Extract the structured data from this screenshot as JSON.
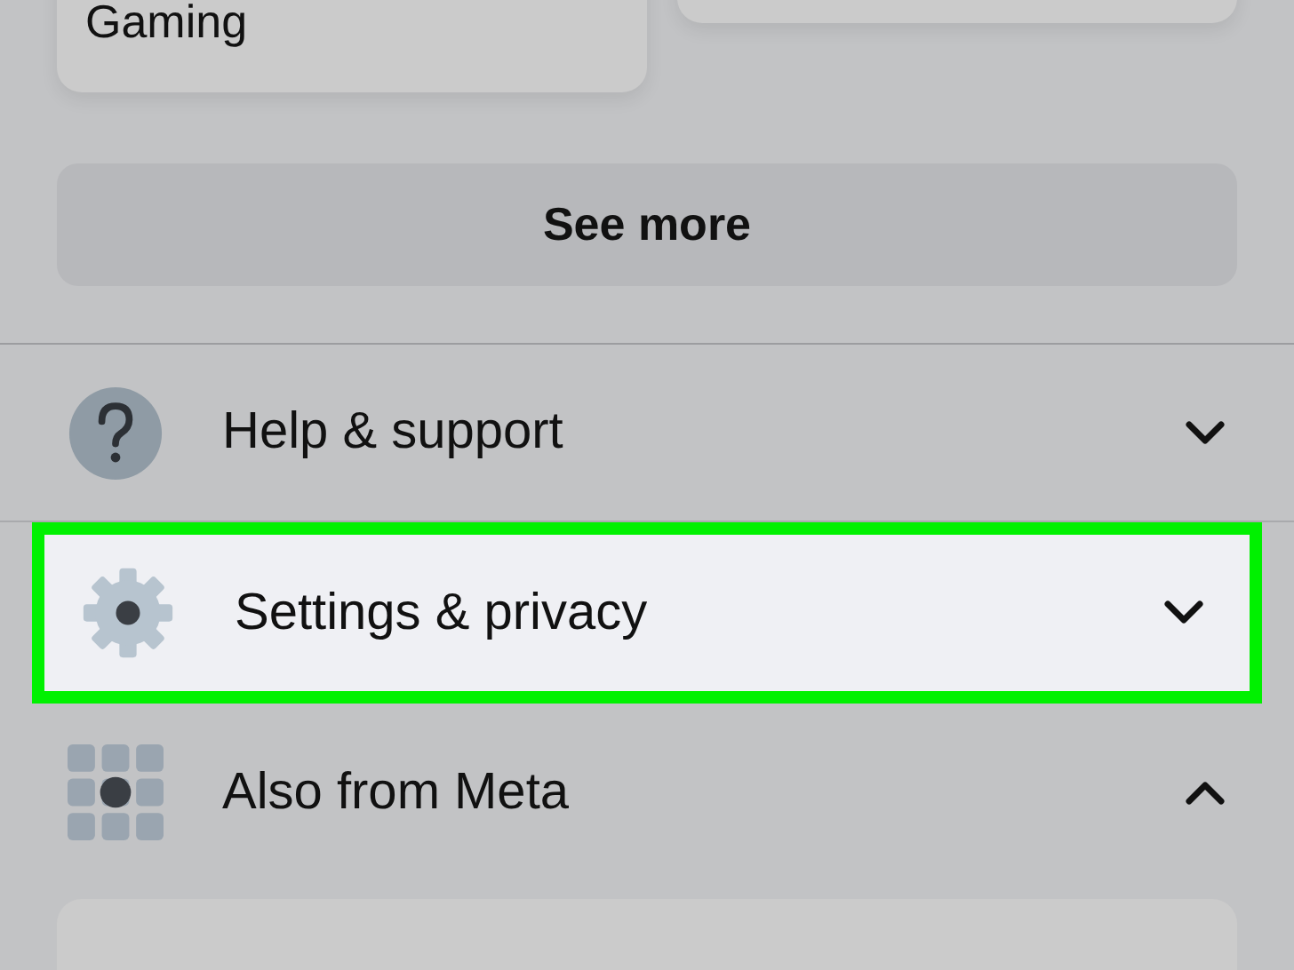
{
  "shortcut_cards": [
    {
      "kind": "labeled",
      "label": "Gaming"
    },
    {
      "kind": "blank"
    }
  ],
  "see_more_button": {
    "label": "See more"
  },
  "menu_items": [
    {
      "kind": "help",
      "label": "Help & support",
      "expanded": false,
      "highlighted": false
    },
    {
      "kind": "settings",
      "label": "Settings & privacy",
      "expanded": false,
      "highlighted": true
    },
    {
      "kind": "apps",
      "label": "Also from Meta",
      "expanded": true,
      "highlighted": false
    }
  ]
}
